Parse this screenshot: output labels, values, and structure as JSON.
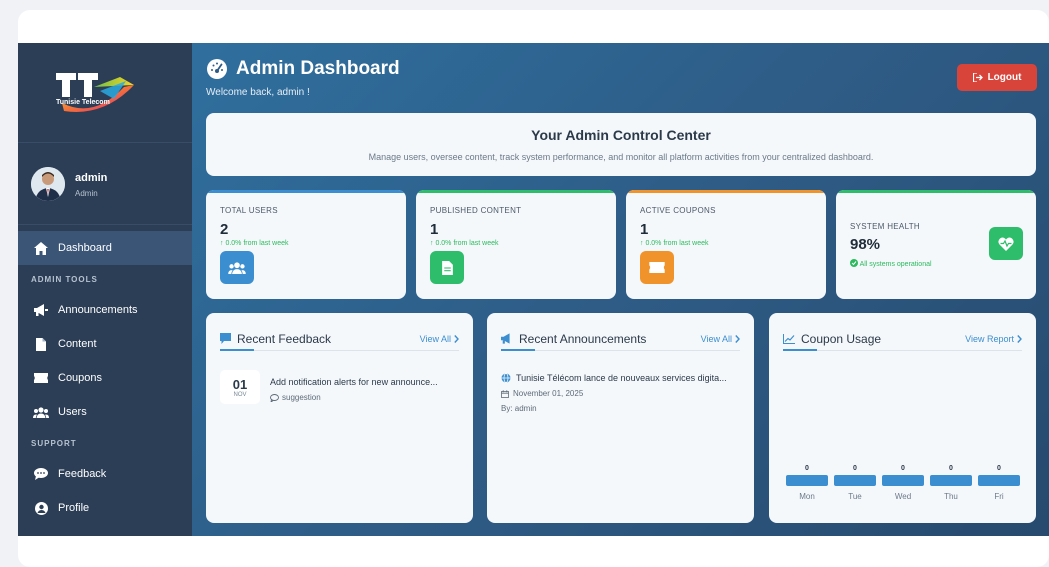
{
  "brand": {
    "logo_text": "Tunisie Telecom"
  },
  "user": {
    "name": "admin",
    "role": "Admin"
  },
  "sidebar": {
    "items": [
      {
        "label": "Dashboard",
        "icon": "home-icon",
        "active": true
      },
      {
        "section": "ADMIN TOOLS"
      },
      {
        "label": "Announcements",
        "icon": "megaphone-icon"
      },
      {
        "label": "Content",
        "icon": "file-icon"
      },
      {
        "label": "Coupons",
        "icon": "ticket-icon"
      },
      {
        "label": "Users",
        "icon": "users-icon"
      },
      {
        "section": "SUPPORT"
      },
      {
        "label": "Feedback",
        "icon": "chat-icon"
      },
      {
        "label": "Profile",
        "icon": "user-circle-icon"
      }
    ]
  },
  "header": {
    "title": "Admin Dashboard",
    "welcome": "Welcome back, admin !",
    "logout_label": "Logout"
  },
  "control_center": {
    "title": "Your Admin Control Center",
    "description": "Manage users, oversee content, track system performance, and monitor all platform activities from your centralized dashboard."
  },
  "stats": [
    {
      "label": "TOTAL USERS",
      "value": "2",
      "change": "0.0% from last week",
      "color": "#3b8ed0",
      "icon": "users-icon"
    },
    {
      "label": "PUBLISHED CONTENT",
      "value": "1",
      "change": "0.0% from last week",
      "color": "#2ebd6b",
      "icon": "file-icon"
    },
    {
      "label": "ACTIVE COUPONS",
      "value": "1",
      "change": "0.0% from last week",
      "color": "#f0932b",
      "icon": "ticket-icon"
    },
    {
      "label": "SYSTEM HEALTH",
      "value": "98%",
      "change": "All systems operational",
      "color": "#2ebd6b",
      "icon": "heartbeat-icon"
    }
  ],
  "feedback": {
    "title": "Recent Feedback",
    "link": "View All",
    "items": [
      {
        "day": "01",
        "month": "NOV",
        "text": "Add notification alerts for new announce...",
        "tag": "suggestion"
      }
    ]
  },
  "announcements": {
    "title": "Recent Announcements",
    "link": "View All",
    "items": [
      {
        "title": "Tunisie Télécom lance de nouveaux services digita...",
        "date": "November 01, 2025",
        "by": "By: admin"
      }
    ]
  },
  "coupon_usage": {
    "title": "Coupon Usage",
    "link": "View Report"
  },
  "chart_data": {
    "type": "bar",
    "title": "Coupon Usage",
    "categories": [
      "Mon",
      "Tue",
      "Wed",
      "Thu",
      "Fri"
    ],
    "values": [
      0,
      0,
      0,
      0,
      0
    ],
    "color": "#3b8ed0",
    "grid": false
  }
}
